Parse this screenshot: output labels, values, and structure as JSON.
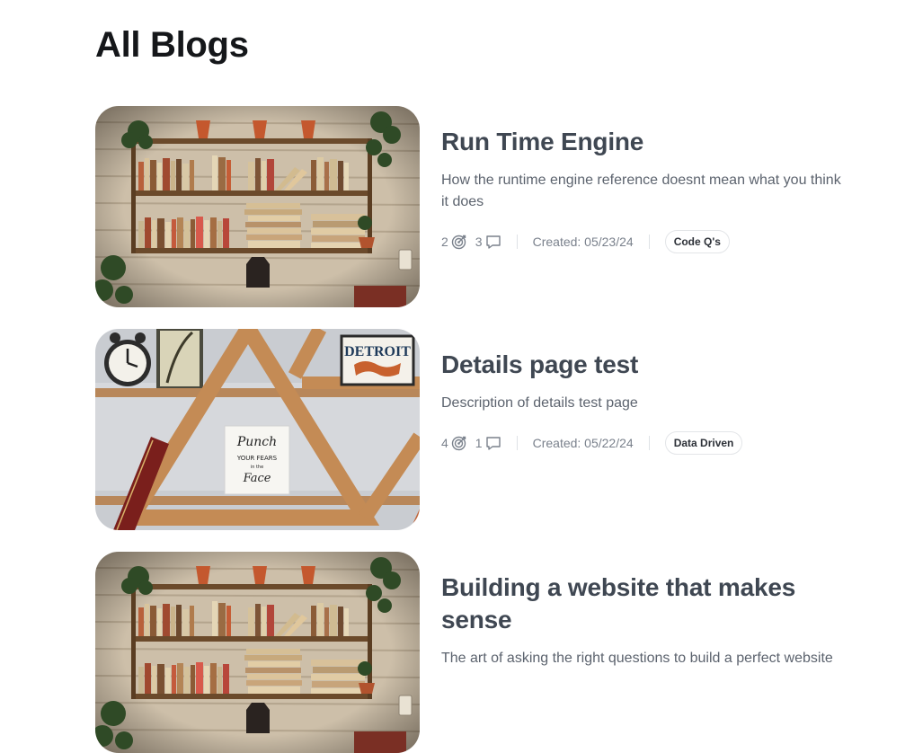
{
  "page": {
    "title": "All Blogs"
  },
  "posts": [
    {
      "title": "Run Time Engine",
      "description": "How the runtime engine reference doesnt mean what you think it does",
      "goals": "2",
      "comments": "3",
      "created": "Created: 05/23/24",
      "tag": "Code Q's",
      "image": "bookshelf-wall-photo"
    },
    {
      "title": "Details page test",
      "description": "Description of details test page",
      "goals": "4",
      "comments": "1",
      "created": "Created: 05/22/24",
      "tag": "Data Driven",
      "image": "triangle-shelf-photo",
      "image_text": {
        "sign_line_1": "DETROIT",
        "poster_line_1": "Punch",
        "poster_line_2": "YOUR FEARS",
        "poster_line_3": "in the",
        "poster_line_4": "Face"
      }
    },
    {
      "title": "Building a website that makes sense",
      "description": "The art of asking the right questions to build a perfect website",
      "image": "bookshelf-wall-photo"
    }
  ],
  "icons": {
    "goal": "target-icon",
    "comment": "comment-icon"
  },
  "colors": {
    "title": "#15171a",
    "post_title": "#3f4752",
    "muted": "#7a818c",
    "border": "#e3e5e8"
  }
}
